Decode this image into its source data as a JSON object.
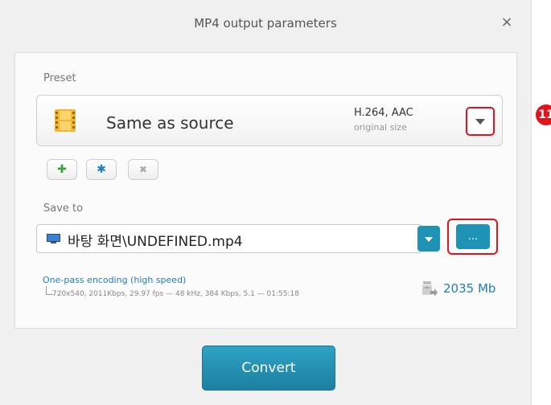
{
  "dialog": {
    "title": "MP4 output parameters",
    "close_symbol": "×"
  },
  "preset": {
    "label": "Preset",
    "name": "Same as source",
    "codec": "H.264, AAC",
    "size": "original size",
    "actions": {
      "add_symbol": "✚",
      "settings_symbol": "✱",
      "remove_symbol": "✖"
    }
  },
  "save_to": {
    "label": "Save to",
    "path": "바탕 화면\\UNDEFINED.mp4",
    "browse_label": "..."
  },
  "encoding": {
    "mode": "One-pass encoding (high speed)",
    "details": "720x540, 2011Kbps, 29.97 fps — 48 kHz, 384 Kbps, 5.1 — 01:55:18"
  },
  "output_size": "2035 Mb",
  "convert_label": "Convert",
  "annotation_badge": "11",
  "colors": {
    "accent": "#1f93b5",
    "highlight": "#e0141b",
    "link": "#1f7ec0"
  },
  "icons": [
    "film-icon",
    "add-icon",
    "settings-icon",
    "remove-icon",
    "monitor-icon",
    "disk-size-icon",
    "close-icon",
    "chevron-down-icon"
  ]
}
